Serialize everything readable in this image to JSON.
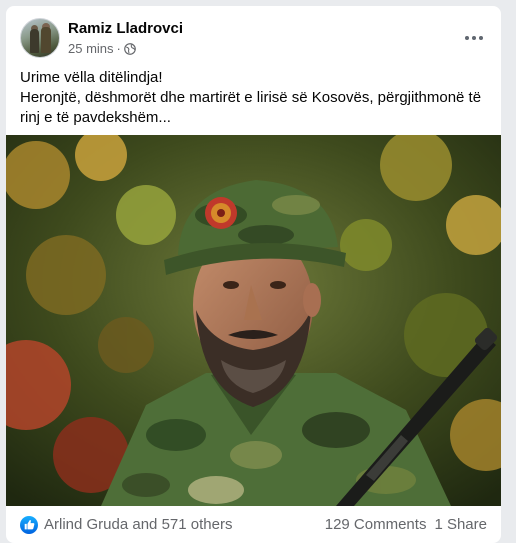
{
  "post": {
    "author": "Ramiz Lladrovci",
    "time": "25 mins",
    "separator": "·",
    "privacy_icon": "globe-icon",
    "more_icon": "more-options-icon",
    "text_line1": "Urime vëlla ditëlindja!",
    "text_line2": "Heronjtë, dëshmorët dhe martirët e lirisë së Kosovës, përgjithmonë të rinj e të pavdekshëm..."
  },
  "reactions": {
    "icon": "like-icon",
    "summary": "Arlind Gruda and 571 others",
    "comments": "129 Comments",
    "shares": "1 Share"
  },
  "colors": {
    "accent": "#1877f2",
    "text_primary": "#050505",
    "text_secondary": "#65676b",
    "background": "#e9ebee"
  }
}
